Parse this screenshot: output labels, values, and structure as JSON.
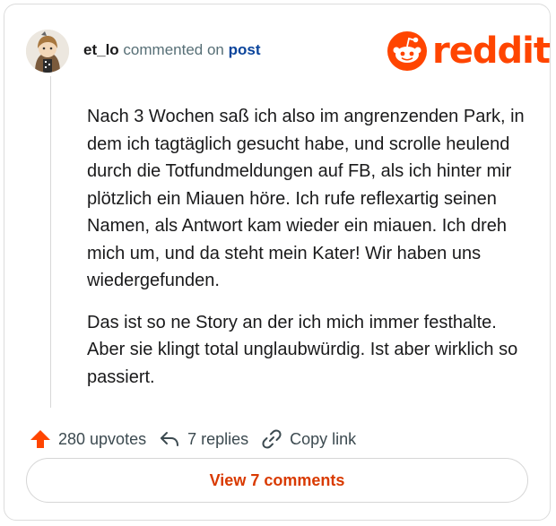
{
  "comment": {
    "username": "et_lo",
    "action_text": "commented on",
    "post_link": "post",
    "body_paragraphs": [
      "Nach 3 Wochen saß ich also im angrenzenden Park, in dem ich tagtäglich gesucht habe, und scrolle heulend durch die Totfundmeldungen auf FB, als ich hinter mir plötzlich ein Miauen höre. Ich rufe reflexartig seinen Namen, als Antwort kam wieder ein miauen. Ich dreh mich um, und da steht mein Kater! Wir haben uns wiedergefunden.",
      "Das ist so ne Story an der ich mich immer festhalte. Aber sie klingt total unglaubwürdig. Ist aber wirklich so passiert."
    ]
  },
  "brand": {
    "logo_text": "reddit",
    "color": "#ff4500"
  },
  "actions": {
    "upvotes": "280 upvotes",
    "replies": "7 replies",
    "copy_link": "Copy link"
  },
  "footer": {
    "view_comments_label": "View 7 comments"
  },
  "icons": {
    "upvote": "upvote-arrow-icon",
    "reply": "reply-arrow-icon",
    "link": "link-chain-icon",
    "logo": "reddit-snoo-icon"
  }
}
